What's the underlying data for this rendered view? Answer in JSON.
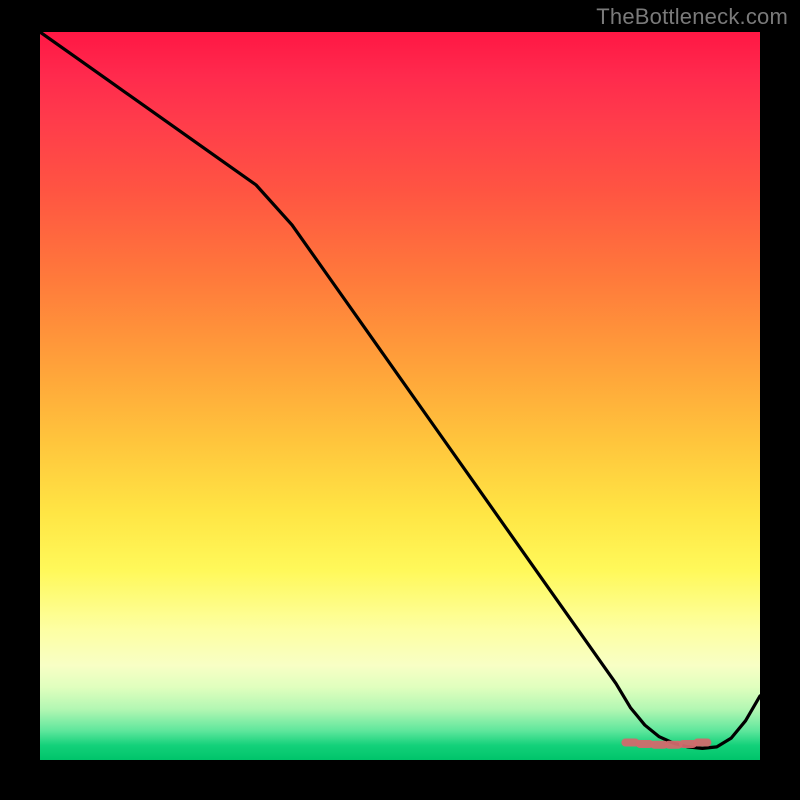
{
  "attribution": "TheBottleneck.com",
  "chart_data": {
    "type": "line",
    "title": "",
    "xlabel": "",
    "ylabel": "",
    "xlim": [
      0,
      100
    ],
    "ylim": [
      0,
      100
    ],
    "grid": false,
    "legend": null,
    "x": [
      0,
      5,
      10,
      15,
      20,
      25,
      30,
      35,
      40,
      45,
      50,
      55,
      60,
      65,
      70,
      75,
      80,
      82,
      84,
      86,
      88,
      90,
      92,
      94,
      96,
      98,
      100
    ],
    "y": [
      100,
      96.5,
      93,
      89.5,
      86,
      82.5,
      79,
      73.5,
      66.5,
      59.5,
      52.5,
      45.5,
      38.5,
      31.5,
      24.5,
      17.5,
      10.5,
      7.2,
      4.8,
      3.2,
      2.3,
      1.8,
      1.6,
      1.8,
      3.0,
      5.4,
      8.8
    ],
    "markers": {
      "x": [
        82,
        84,
        86,
        88,
        90,
        92
      ],
      "y": [
        2.4,
        2.2,
        2.1,
        2.1,
        2.2,
        2.4
      ]
    },
    "background_gradient": {
      "direction": "top-to-bottom",
      "stops": [
        {
          "pos": 0.0,
          "color": "#ff1744"
        },
        {
          "pos": 0.46,
          "color": "#ffa23a"
        },
        {
          "pos": 0.74,
          "color": "#fff95a"
        },
        {
          "pos": 1.0,
          "color": "#00c46a"
        }
      ]
    }
  }
}
